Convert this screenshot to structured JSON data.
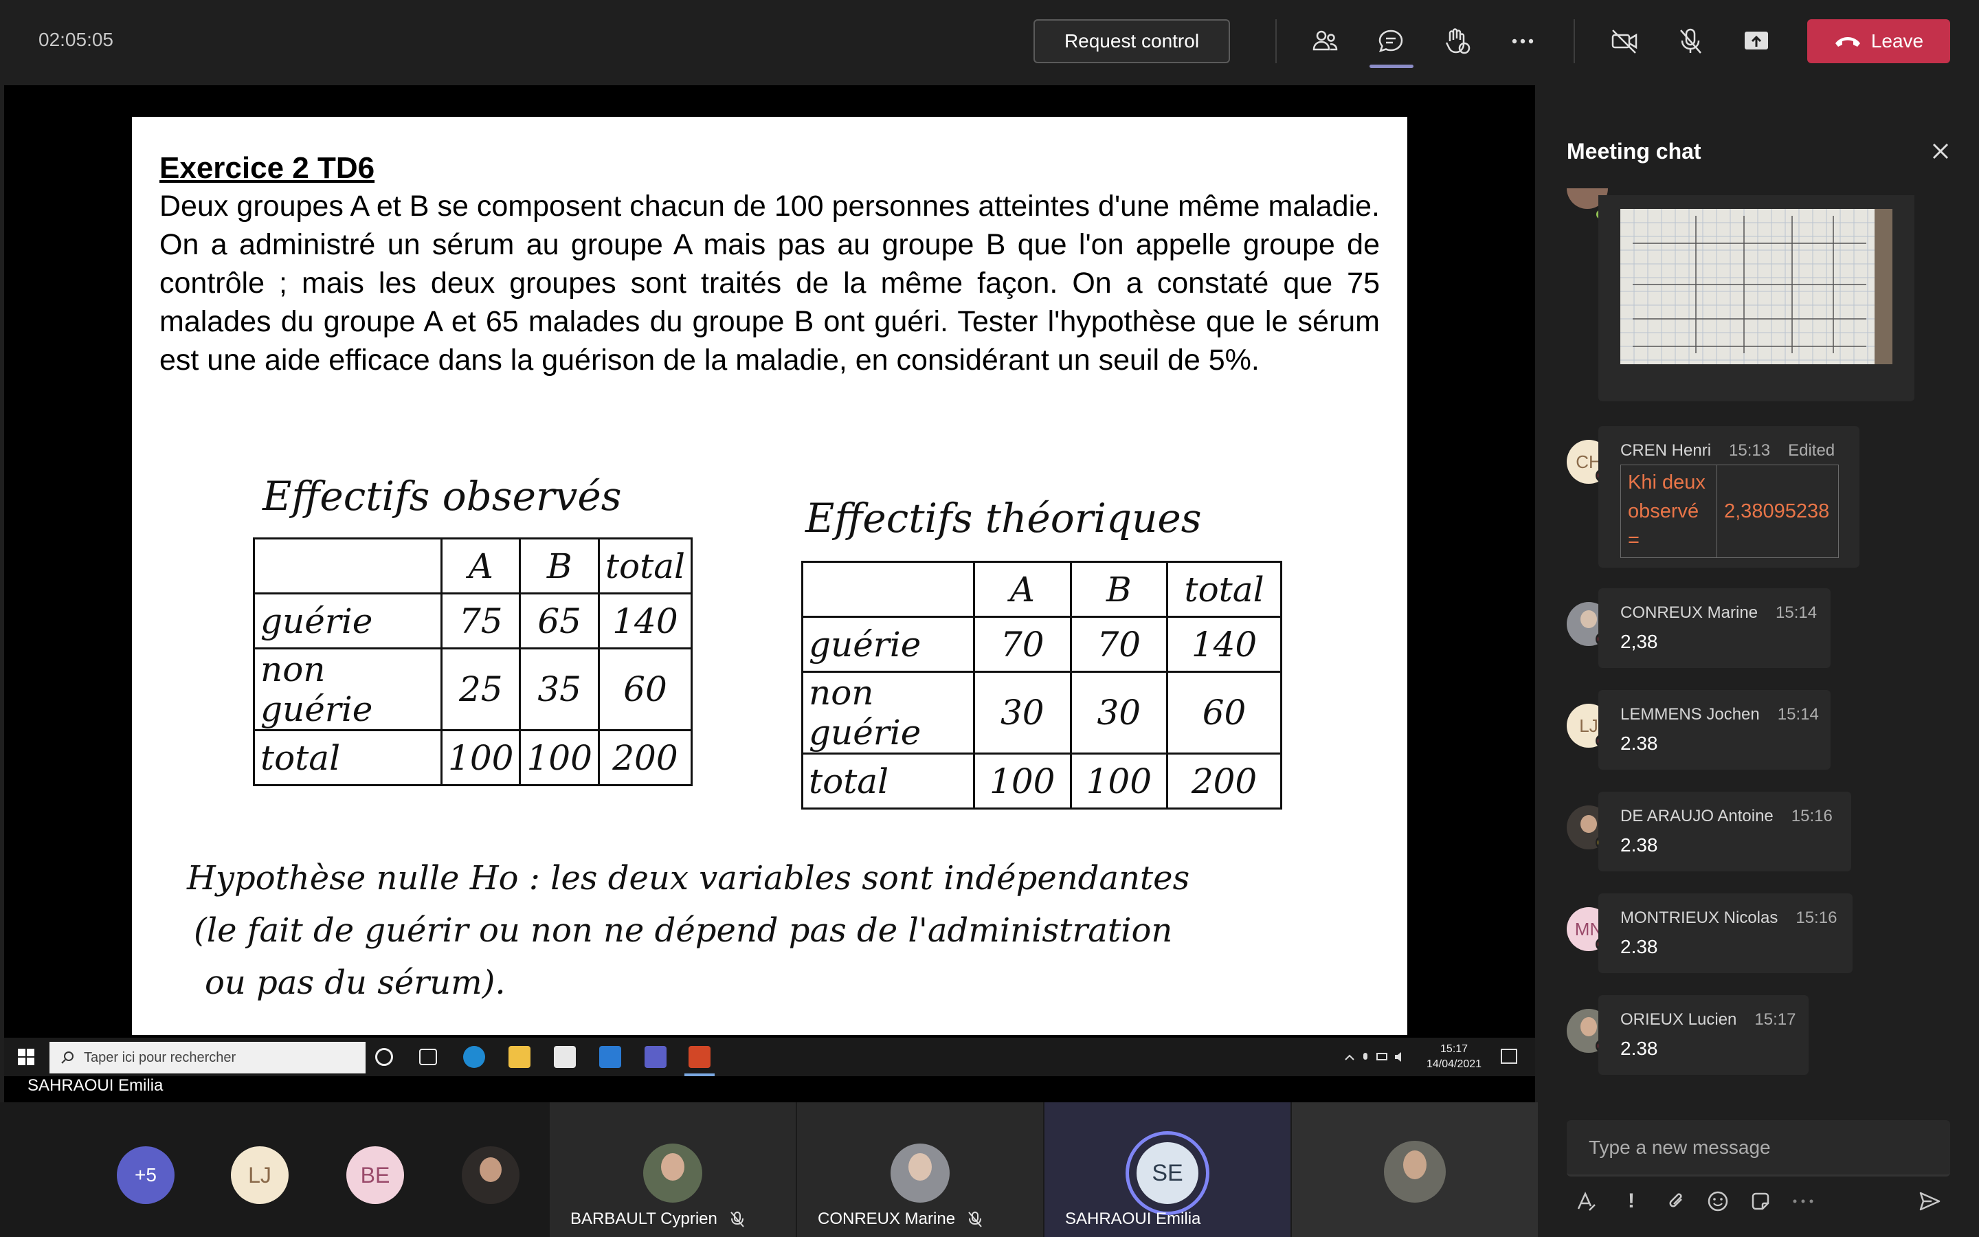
{
  "topbar": {
    "timer": "02:05:05",
    "request_control": "Request control",
    "leave": "Leave"
  },
  "slide": {
    "title": "Exercice 2 TD6",
    "body": "Deux groupes A et B se composent chacun de 100 personnes atteintes d'une même maladie. On a administré un sérum au groupe A mais pas au groupe B que l'on appelle groupe de contrôle ; mais les deux groupes sont traités de la même façon. On a constaté que 75 malades du groupe A et 65 malades du groupe B ont guéri. Tester l'hypothèse que le sérum est une aide efficace dans la guérison de la maladie, en considérant un seuil de 5%.",
    "observed": {
      "title": "Effectifs observés",
      "headers": [
        "A",
        "B",
        "total"
      ],
      "rows": [
        {
          "label": "guérie",
          "a": "75",
          "b": "65",
          "t": "140"
        },
        {
          "label": "non guérie",
          "a": "25",
          "b": "35",
          "t": "60"
        },
        {
          "label": "total",
          "a": "100",
          "b": "100",
          "t": "200"
        }
      ]
    },
    "theoretical": {
      "title": "Effectifs théoriques",
      "headers": [
        "A",
        "B",
        "total"
      ],
      "rows": [
        {
          "label": "guérie",
          "a": "70",
          "b": "70",
          "t": "140"
        },
        {
          "label": "non guérie",
          "a": "30",
          "b": "30",
          "t": "60"
        },
        {
          "label": "total",
          "a": "100",
          "b": "100",
          "t": "200"
        }
      ]
    },
    "hypothesis_l1": "Hypothèse nulle Ho : les deux variables sont indépendantes",
    "hypothesis_l2": "(le fait de guérir ou non ne dépend pas de l'administration",
    "hypothesis_l3": "ou pas du sérum)."
  },
  "taskbar": {
    "search_placeholder": "Taper ici pour rechercher",
    "time": "15:17",
    "date": "14/04/2021"
  },
  "stage_presenter": "SAHRAOUI Emilia",
  "chat": {
    "title": "Meeting chat",
    "messages": [
      {
        "initials": "CH",
        "name": "CREN Henri",
        "time": "15:13",
        "edited": "Edited",
        "cell1": "Khi deux observé =",
        "cell2": "2,38095238"
      },
      {
        "initials": "",
        "name": "CONREUX Marine",
        "time": "15:14",
        "text": "2,38"
      },
      {
        "initials": "LJ",
        "name": "LEMMENS Jochen",
        "time": "15:14",
        "text": "2.38"
      },
      {
        "initials": "",
        "name": "DE ARAUJO Antoine",
        "time": "15:16",
        "text": "2.38"
      },
      {
        "initials": "MN",
        "name": "MONTRIEUX Nicolas",
        "time": "15:16",
        "text": "2.38"
      },
      {
        "initials": "",
        "name": "ORIEUX Lucien",
        "time": "15:17",
        "text": "2.38"
      }
    ],
    "compose_placeholder": "Type a new message"
  },
  "participants": {
    "overflow": "+5",
    "avatars": [
      "LJ",
      "BE"
    ],
    "tiles": [
      {
        "name": "BARBAULT Cyprien"
      },
      {
        "name": "CONREUX Marine"
      },
      {
        "name": "SAHRAOUI Emilia",
        "initials": "SE"
      }
    ]
  },
  "colors": {
    "accent": "#8b8cc7",
    "leave": "#c4314b",
    "edited_text": "#e97548",
    "busy": "#c4314b",
    "away": "#f8d22a",
    "available": "#92c353"
  }
}
